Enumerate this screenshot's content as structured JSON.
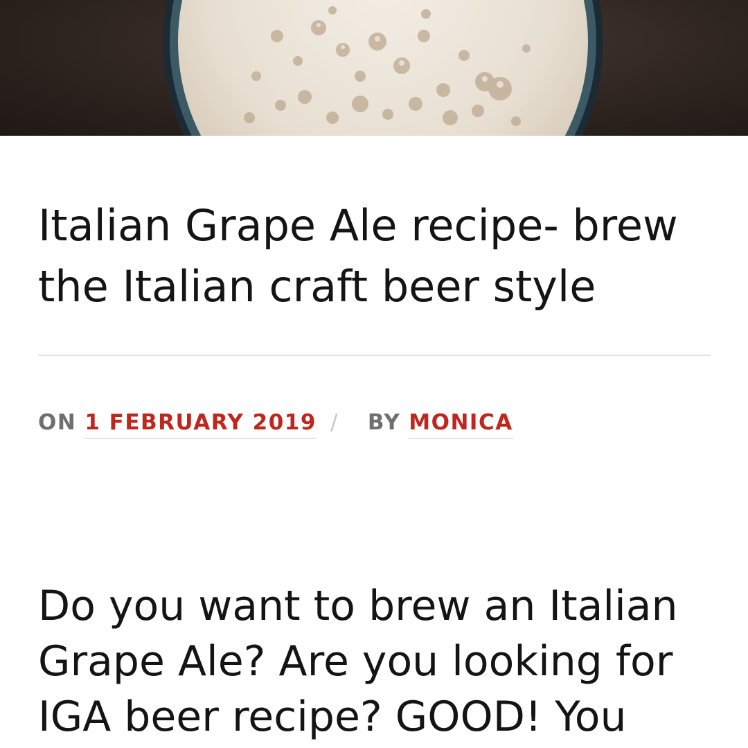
{
  "post": {
    "title": "Italian Grape Ale recipe- brew the Italian craft beer style",
    "meta": {
      "on_label": "ON",
      "date": "1 FEBRUARY 2019",
      "separator": "/",
      "by_label": "BY",
      "author": "MONICA"
    },
    "lead": "Do you want to brew an Italian Grape Ale? Are you looking for IGA beer recipe? GOOD! You"
  },
  "colors": {
    "link": "#c0261e",
    "text": "#141414",
    "meta": "#6f6f6f"
  }
}
